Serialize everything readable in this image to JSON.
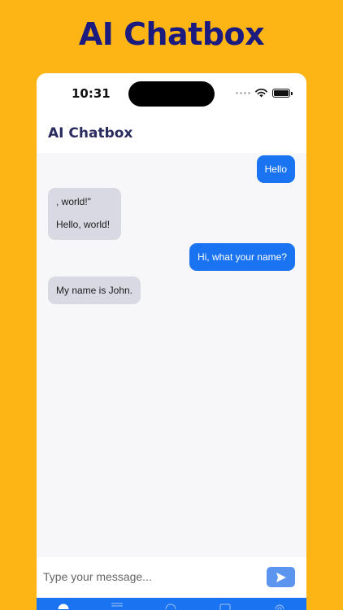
{
  "promo": {
    "title": "AI Chatbox"
  },
  "status_bar": {
    "time": "10:31"
  },
  "header": {
    "title": "AI Chatbox"
  },
  "messages": [
    {
      "sender": "user",
      "lines": [
        "Hello"
      ]
    },
    {
      "sender": "bot",
      "lines": [
        ", world!\"",
        "Hello, world!"
      ]
    },
    {
      "sender": "user",
      "lines": [
        "Hi, what your name?"
      ]
    },
    {
      "sender": "bot",
      "lines": [
        "My name is John."
      ]
    }
  ],
  "input": {
    "placeholder": "Type your message..."
  },
  "tabs": [
    {
      "icon": "chat-bubble-icon"
    },
    {
      "icon": "list-icon"
    },
    {
      "icon": "circle-icon"
    },
    {
      "icon": "image-icon"
    },
    {
      "icon": "gear-icon"
    }
  ],
  "colors": {
    "background": "#FDB515",
    "promo_title": "#1B1A7E",
    "user_bubble": "#1A73F0",
    "bot_bubble": "#D8D9E3",
    "tab_bar": "#1A73F0"
  }
}
